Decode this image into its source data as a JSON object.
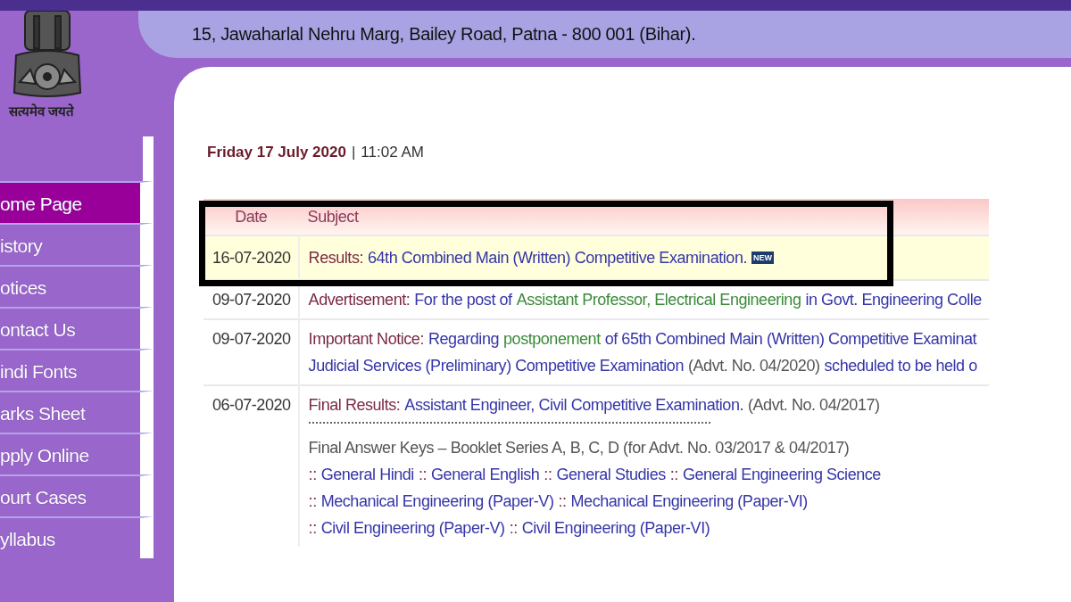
{
  "header": {
    "motto": "सत्यमेव जयते",
    "address": "15, Jawaharlal Nehru Marg, Bailey Road, Patna - 800 001 (Bihar)."
  },
  "sidebar": {
    "items": [
      {
        "label": "ome Page",
        "selected": true
      },
      {
        "label": "istory",
        "selected": false
      },
      {
        "label": "otices",
        "selected": false
      },
      {
        "label": "ontact Us",
        "selected": false
      },
      {
        "label": "indi Fonts",
        "selected": false
      },
      {
        "label": "arks Sheet",
        "selected": false
      },
      {
        "label": "pply Online",
        "selected": false
      },
      {
        "label": "ourt Cases",
        "selected": false
      },
      {
        "label": "yllabus",
        "selected": false
      }
    ]
  },
  "datetime": {
    "date": "Friday 17 July 2020",
    "separator": "|",
    "time": "11:02 AM"
  },
  "table": {
    "columns": [
      "Date",
      "Subject"
    ],
    "rows": [
      {
        "date": "16-07-2020",
        "highlighted": true,
        "lines": [
          {
            "kind": "text",
            "segments": [
              {
                "kind": "label",
                "text": "Results:"
              },
              {
                "kind": "link",
                "text": "64th Combined Main (Written) Competitive Examination."
              },
              {
                "kind": "badge",
                "text": "NEW"
              }
            ]
          }
        ]
      },
      {
        "date": "09-07-2020",
        "highlighted": false,
        "lines": [
          {
            "kind": "text",
            "segments": [
              {
                "kind": "label",
                "text": "Advertisement:"
              },
              {
                "kind": "link",
                "text": "For the post of"
              },
              {
                "kind": "green",
                "text": "Assistant Professor, Electrical Engineering"
              },
              {
                "kind": "link",
                "text": "in Govt. Engineering Colle"
              }
            ]
          }
        ]
      },
      {
        "date": "09-07-2020",
        "highlighted": false,
        "lines": [
          {
            "kind": "text",
            "segments": [
              {
                "kind": "label",
                "text": "Important Notice:"
              },
              {
                "kind": "link",
                "text": "Regarding"
              },
              {
                "kind": "green",
                "text": "postponement"
              },
              {
                "kind": "link",
                "text": "of 65th Combined Main (Written) Competitive Examinat"
              }
            ]
          },
          {
            "kind": "text",
            "segments": [
              {
                "kind": "link",
                "text": "Judicial Services (Preliminary) Competitive Examination"
              },
              {
                "kind": "plain",
                "text": "(Advt. No. 04/2020)"
              },
              {
                "kind": "link",
                "text": "scheduled to be held o"
              }
            ]
          }
        ]
      },
      {
        "date": "06-07-2020",
        "highlighted": false,
        "lines": [
          {
            "kind": "text",
            "segments": [
              {
                "kind": "label",
                "text": "Final Results:"
              },
              {
                "kind": "link",
                "text": "Assistant Engineer, Civil Competitive Examination."
              },
              {
                "kind": "plain",
                "text": "(Advt. No. 04/2017)"
              }
            ]
          },
          {
            "kind": "rule"
          },
          {
            "kind": "text",
            "segments": [
              {
                "kind": "plain",
                "text": "Final Answer Keys – Booklet Series A, B, C, D (for Advt. No. 03/2017 & 04/2017)"
              }
            ]
          },
          {
            "kind": "text",
            "segments": [
              {
                "kind": "sep",
                "text": "::"
              },
              {
                "kind": "link",
                "text": "General Hindi"
              },
              {
                "kind": "sep",
                "text": "::"
              },
              {
                "kind": "link",
                "text": "General English"
              },
              {
                "kind": "sep",
                "text": "::"
              },
              {
                "kind": "link",
                "text": "General Studies"
              },
              {
                "kind": "sep",
                "text": "::"
              },
              {
                "kind": "link",
                "text": "General Engineering Science"
              }
            ]
          },
          {
            "kind": "text",
            "segments": [
              {
                "kind": "sep",
                "text": "::"
              },
              {
                "kind": "link",
                "text": "Mechanical Engineering (Paper-V)"
              },
              {
                "kind": "sep",
                "text": "::"
              },
              {
                "kind": "link",
                "text": "Mechanical Engineering (Paper-VI)"
              }
            ]
          },
          {
            "kind": "text",
            "segments": [
              {
                "kind": "sep",
                "text": "::"
              },
              {
                "kind": "link",
                "text": "Civil Engineering (Paper-V)"
              },
              {
                "kind": "sep",
                "text": "::"
              },
              {
                "kind": "link",
                "text": "Civil Engineering (Paper-VI)"
              }
            ]
          }
        ]
      }
    ]
  }
}
